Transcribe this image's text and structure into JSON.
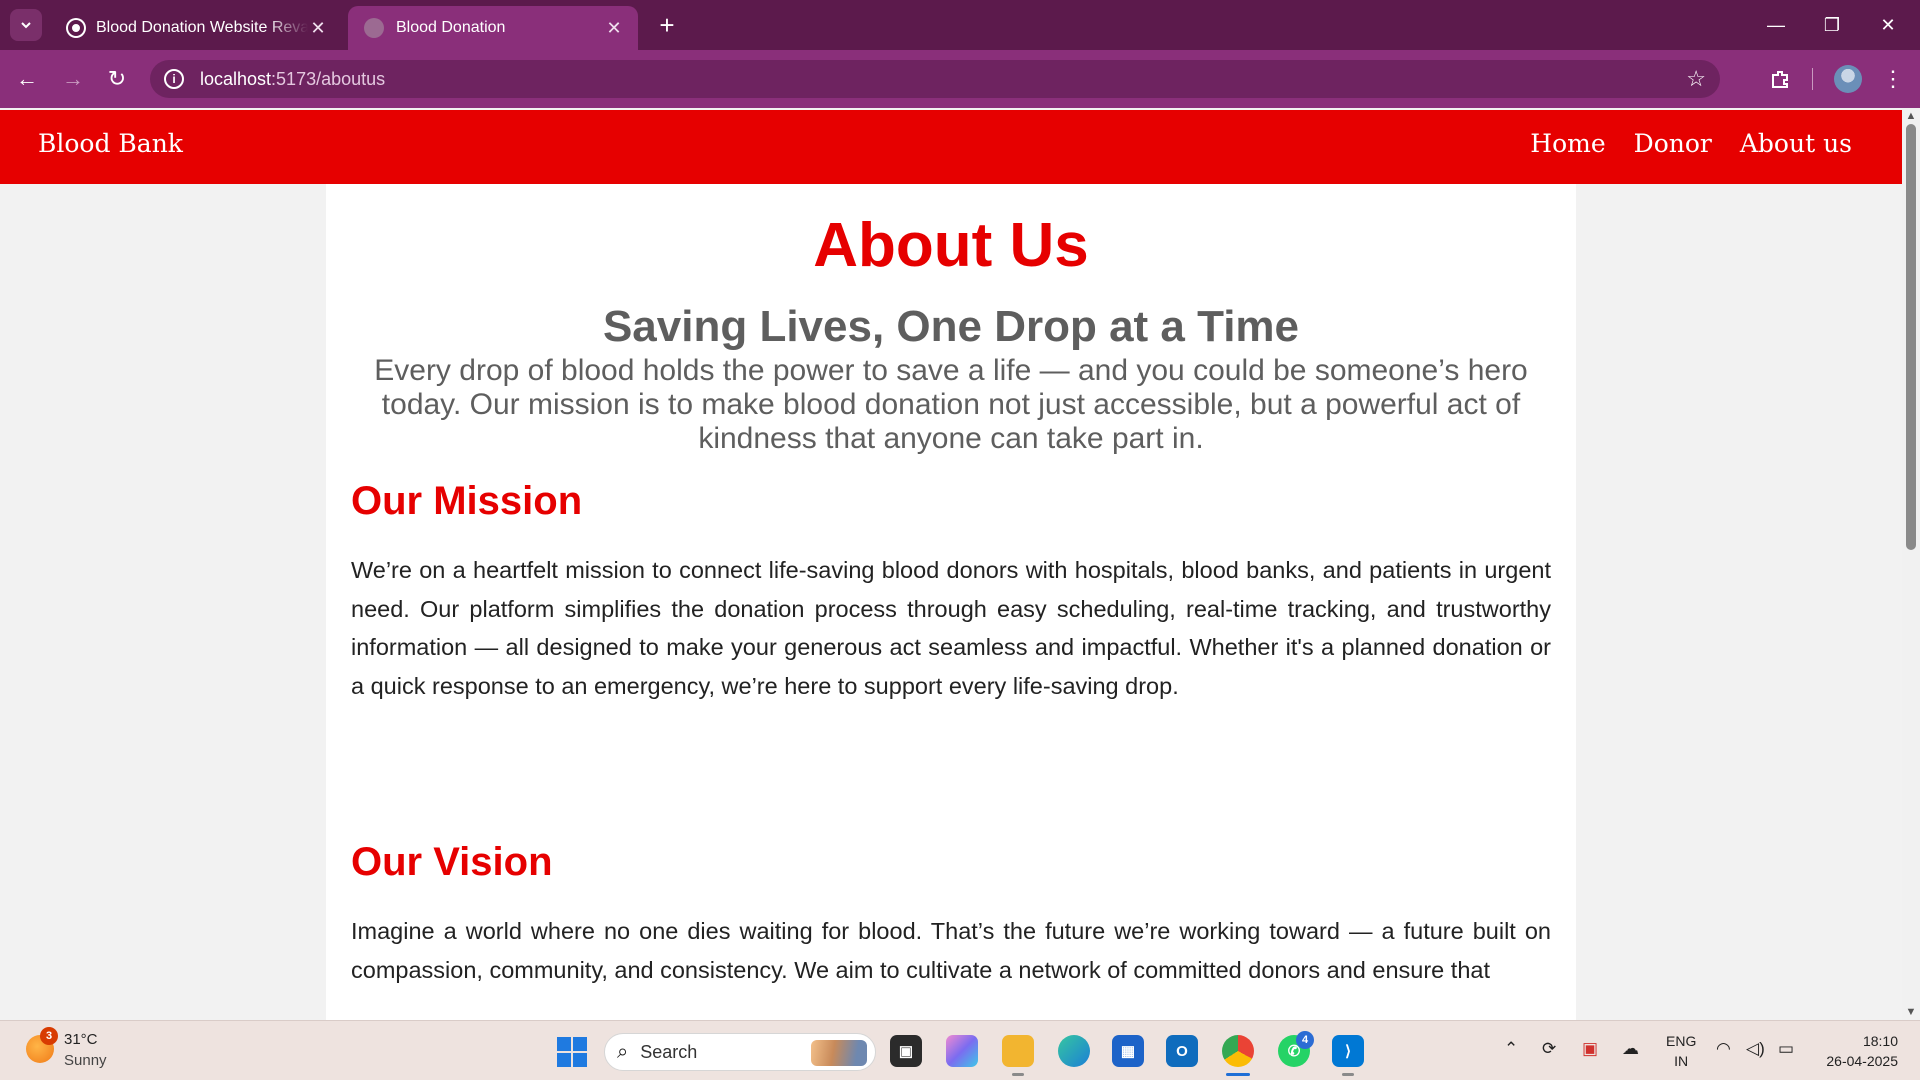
{
  "browser": {
    "tabs": [
      {
        "title": "Blood Donation Website Revamp",
        "active": false
      },
      {
        "title": "Blood Donation",
        "active": true
      }
    ],
    "new_tab_label": "+",
    "address": {
      "host": "localhost",
      "rest": ":5173/aboutus"
    }
  },
  "site": {
    "brand": "Blood Bank",
    "nav": [
      "Home",
      "Donor",
      "About us"
    ],
    "colors": {
      "primary": "#e60000",
      "muted_text": "#5e5e5e",
      "body_text": "#222222"
    }
  },
  "page": {
    "heading": "About Us",
    "tagline": "Saving Lives, One Drop at a Time",
    "intro": "Every drop of blood holds the power to save a life — and you could be someone’s hero today. Our mission is to make blood donation not just accessible, but a powerful act of kindness that anyone can take part in.",
    "mission": {
      "title": "Our Mission",
      "body": "We’re on a heartfelt mission to connect life-saving blood donors with hospitals, blood banks, and patients in urgent need. Our platform simplifies the donation process through easy scheduling, real-time tracking, and trustworthy information — all designed to make your generous act seamless and impactful. Whether it's a planned donation or a quick response to an emergency, we’re here to support every life-saving drop."
    },
    "vision": {
      "title": "Our Vision",
      "body": "Imagine a world where no one dies waiting for blood. That’s the future we’re working toward — a future built on compassion, community, and consistency. We aim to cultivate a network of committed donors and ensure that"
    }
  },
  "taskbar": {
    "weather": {
      "badge": "3",
      "temp": "31°C",
      "condition": "Sunny"
    },
    "search_label": "Search",
    "whatsapp_badge": "4",
    "language": {
      "line1": "ENG",
      "line2": "IN"
    },
    "clock": {
      "time": "18:10",
      "date": "26-04-2025"
    }
  }
}
